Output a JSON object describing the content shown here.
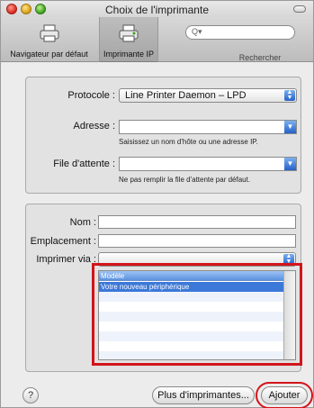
{
  "window": {
    "title": "Choix de l'imprimante"
  },
  "toolbar": {
    "default_label": "Navigateur par défaut",
    "ip_label": "Imprimante IP",
    "search_label": "Rechercher",
    "search_placeholder": ""
  },
  "ip_group": {
    "protocol_label": "Protocole :",
    "protocol_value": "Line Printer Daemon – LPD",
    "address_label": "Adresse :",
    "address_value": "",
    "address_help": "Saisissez un nom d'hôte ou une adresse IP.",
    "queue_label": "File d'attente :",
    "queue_value": "",
    "queue_help": "Ne pas remplir la file d'attente par défaut."
  },
  "printer_group": {
    "name_label": "Nom :",
    "name_value": "",
    "location_label": "Emplacement :",
    "location_value": "",
    "print_via_label": "Imprimer via :",
    "print_via_value": "",
    "list_header": "Modèle",
    "list_items": [
      "Votre nouveau périphérique"
    ]
  },
  "buttons": {
    "help": "?",
    "more_printers": "Plus d'imprimantes...",
    "add": "Ajouter"
  },
  "colors": {
    "highlight": "#d3141b",
    "selection": "#3c78d8"
  }
}
